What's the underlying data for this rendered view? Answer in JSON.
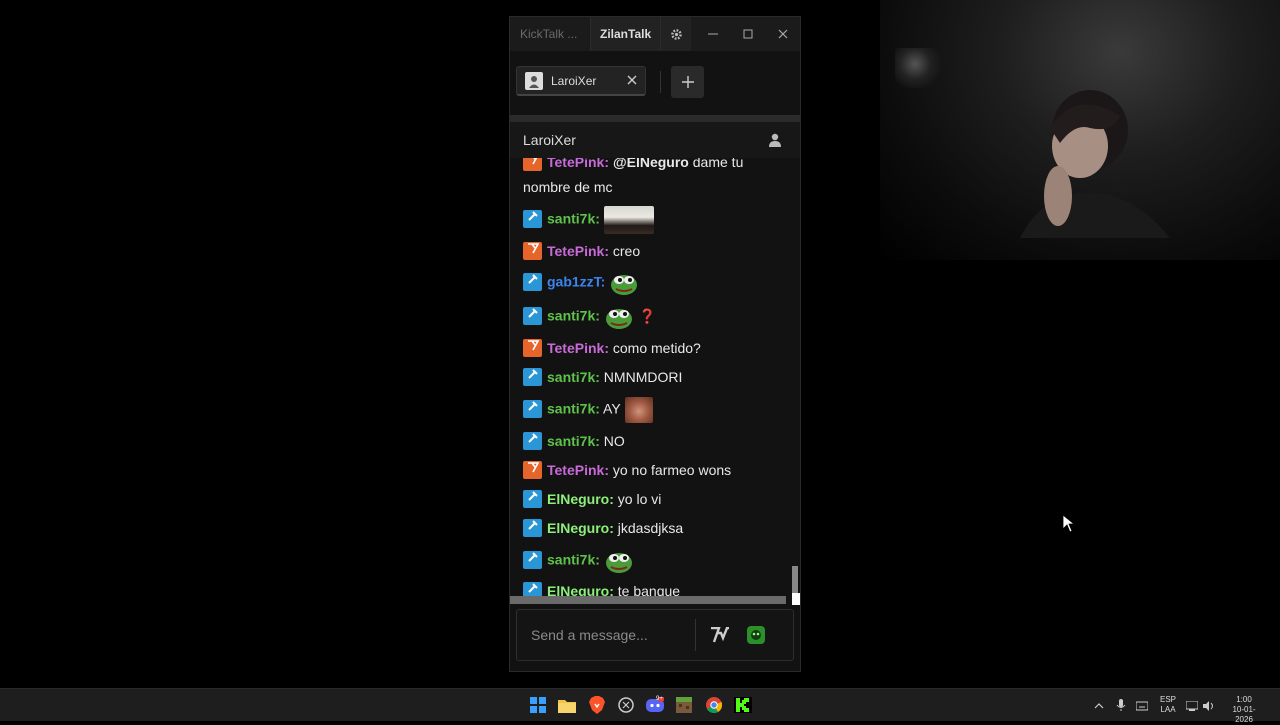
{
  "window": {
    "app_title": "KickTalk ...",
    "user_tab": "ZilanTalk",
    "controls": {
      "minimize": "—",
      "maximize": "☐",
      "close": "✕"
    }
  },
  "tabs": [
    {
      "label": "LaroiXer"
    }
  ],
  "add_tab_label": "+",
  "chat": {
    "channel_name": "LaroiXer",
    "messages": [
      {
        "badge": "tete",
        "user": "TetePink:",
        "mention": "@ElNeguro",
        "text": " dame tu"
      },
      {
        "badge": "",
        "user": "",
        "text": "nombre de mc"
      },
      {
        "badge": "kick",
        "user": "santi7k:",
        "emote": "photo",
        "text": ""
      },
      {
        "badge": "tete",
        "user": "TetePink:",
        "text": " creo"
      },
      {
        "badge": "kick",
        "user": "gab1zzT:",
        "emote": "pepe",
        "text": ""
      },
      {
        "badge": "kick",
        "user": "santi7k:",
        "emote": "pepe",
        "text": "❓"
      },
      {
        "badge": "tete",
        "user": "TetePink:",
        "text": " como metido?"
      },
      {
        "badge": "kick",
        "user": "santi7k:",
        "text": " NMNMDORI"
      },
      {
        "badge": "kick",
        "user": "santi7k:",
        "text": " AY",
        "emote": "man"
      },
      {
        "badge": "kick",
        "user": "santi7k:",
        "text": " NO"
      },
      {
        "badge": "tete",
        "user": "TetePink:",
        "text": " yo no farmeo wons"
      },
      {
        "badge": "kick",
        "user": "ElNeguro:",
        "text": " yo lo vi"
      },
      {
        "badge": "kick",
        "user": "ElNeguro:",
        "text": " jkdasdjksa"
      },
      {
        "badge": "kick",
        "user": "santi7k:",
        "emote": "pepe",
        "text": ""
      },
      {
        "badge": "kick",
        "user": "ElNeguro:",
        "text": " te banque"
      }
    ],
    "composer_placeholder": "Send a message..."
  },
  "taskbar": {
    "lang_top": "ESP",
    "lang_bottom": "LAA",
    "time": "1:00",
    "date": "10-01-2026",
    "discord_badge": "9+"
  },
  "colors": {
    "santi7k": "#5fc24a",
    "TetePink": "#c86bd9",
    "gab1zzT": "#3a85f0",
    "ElNeguro": "#8cf07a",
    "kick_green": "#53fc18"
  }
}
